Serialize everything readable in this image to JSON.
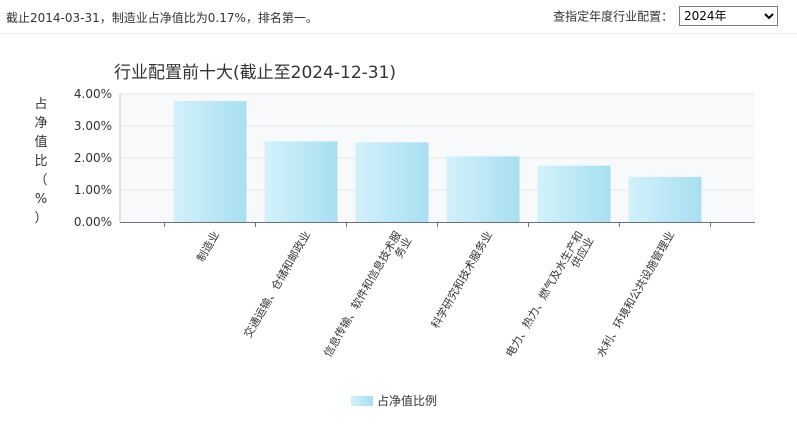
{
  "header": {
    "info_text": "截止2014-03-31，制造业占净值比为0.17%，排名第一。",
    "year_picker_label": "查指定年度行业配置：",
    "year_selected": "2024年"
  },
  "chart_data": {
    "type": "bar",
    "title": "行业配置前十大(截止至2024-12-31)",
    "ylabel": "占净值比（%）",
    "ylim": [
      0,
      4
    ],
    "yticks": [
      "0.00%",
      "1.00%",
      "2.00%",
      "3.00%",
      "4.00%"
    ],
    "categories": [
      "制造业",
      "交通运输、仓储和邮政业",
      "信息传输、软件和信息技术服务业",
      "科学研究和技术服务业",
      "电力、热力、燃气及水生产和供应业",
      "水利、环境和公共设施管理业"
    ],
    "category_lines": [
      [
        "制造业"
      ],
      [
        "交通运输、仓储和邮政业"
      ],
      [
        "信息传输、软件和信息技术服",
        "务业"
      ],
      [
        "科学研究和技术服务业"
      ],
      [
        "电力、热力、燃气及水生产和",
        "供应业"
      ],
      [
        "水利、环境和公共设施管理业"
      ]
    ],
    "series": [
      {
        "name": "占净值比例",
        "values": [
          3.78,
          2.52,
          2.49,
          2.05,
          1.76,
          1.41
        ]
      }
    ],
    "legend": "bottom-center",
    "grid": true
  },
  "colors": {
    "bar_left": "#d3f1fb",
    "bar_right": "#a8dff1",
    "grid": "#e6e6e6",
    "plot_bg": "#f8f9fb"
  }
}
